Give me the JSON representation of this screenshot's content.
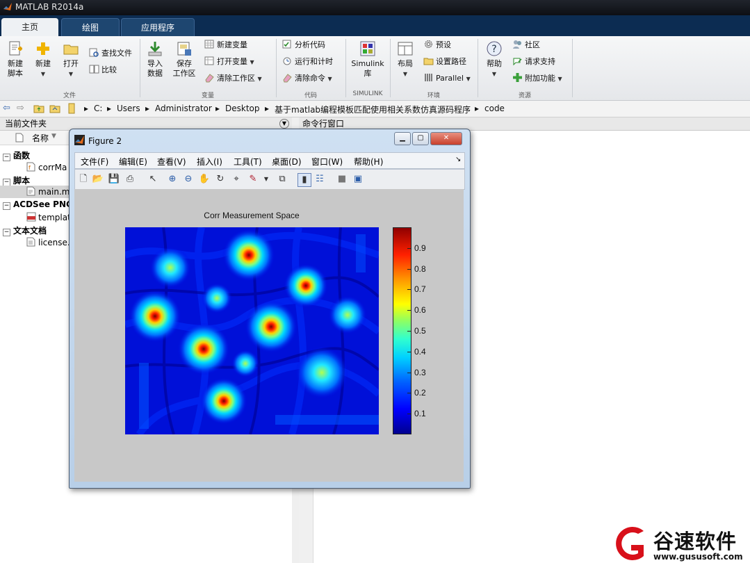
{
  "app": {
    "title": "MATLAB R2014a"
  },
  "tabs": [
    "主页",
    "绘图",
    "应用程序"
  ],
  "ribbon": {
    "file": {
      "new_script_line1": "新建",
      "new_script_line2": "脚本",
      "new_label": "新建",
      "open_label": "打开",
      "find_files": "查找文件",
      "compare": "比较",
      "group": "文件"
    },
    "variable": {
      "import_line1": "导入",
      "import_line2": "数据",
      "save_line1": "保存",
      "save_line2": "工作区",
      "new_var": "新建变量",
      "open_var": "打开变量",
      "clear_ws": "清除工作区",
      "group": "变量"
    },
    "code": {
      "analyze": "分析代码",
      "run_time": "运行和计时",
      "clear_cmd": "清除命令",
      "group": "代码"
    },
    "simulink": {
      "line1": "Simulink",
      "line2": "库",
      "group": "SIMULINK"
    },
    "env": {
      "layout": "布局",
      "prefs": "预设",
      "set_path": "设置路径",
      "parallel": "Parallel",
      "group": "环境"
    },
    "resources": {
      "help": "帮助",
      "community": "社区",
      "support": "请求支持",
      "addons": "附加功能",
      "group": "资源"
    }
  },
  "path": [
    "C:",
    "Users",
    "Administrator",
    "Desktop",
    "基于matlab编程模板匹配使用相关系数仿真源码程序",
    "code"
  ],
  "current_folder": {
    "title": "当前文件夹",
    "column": "名称",
    "groups": [
      {
        "label": "函数",
        "items": [
          "corrMa"
        ]
      },
      {
        "label": "脚本",
        "items": [
          "main.m"
        ]
      },
      {
        "label": "ACDSee PNG",
        "items": [
          "templat"
        ]
      },
      {
        "label": "文本文档",
        "items": [
          "license."
        ]
      }
    ]
  },
  "command_window": {
    "title": "命令行窗口"
  },
  "figure": {
    "title": "Figure 2",
    "menu": [
      "文件(F)",
      "编辑(E)",
      "查看(V)",
      "插入(I)",
      "工具(T)",
      "桌面(D)",
      "窗口(W)",
      "帮助(H)"
    ],
    "plot_title": "Corr Measurement Space"
  },
  "chart_data": {
    "type": "heatmap",
    "title": "Corr Measurement Space",
    "colormap": "jet",
    "clim": [
      0,
      1
    ],
    "colorbar_ticks": [
      0.1,
      0.2,
      0.3,
      0.4,
      0.5,
      0.6,
      0.7,
      0.8,
      0.9
    ],
    "peaks": [
      {
        "value": 0.95
      },
      {
        "value": 0.55
      },
      {
        "value": 0.9
      },
      {
        "value": 0.85
      },
      {
        "value": 0.4
      },
      {
        "value": 0.9
      },
      {
        "value": 0.55
      },
      {
        "value": 0.95
      },
      {
        "value": 0.9
      },
      {
        "value": 0.45
      },
      {
        "value": 0.6
      },
      {
        "value": 0.95
      }
    ]
  },
  "watermark": {
    "brand": "谷速软件",
    "url": "www.gususoft.com"
  }
}
